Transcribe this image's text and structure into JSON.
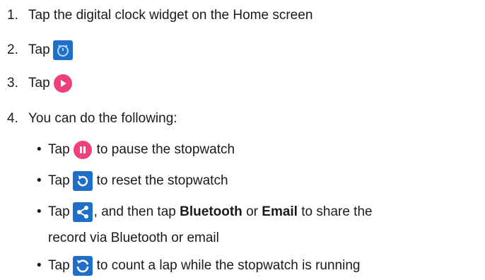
{
  "steps": [
    {
      "num": "1.",
      "text": "Tap the digital clock widget on the Home screen"
    },
    {
      "num": "2.",
      "pre": "Tap",
      "icon": "alarm-timer-icon"
    },
    {
      "num": "3.",
      "pre": "Tap",
      "icon": "play-icon"
    },
    {
      "num": "4.",
      "text": "You can do the following:"
    }
  ],
  "substeps": [
    {
      "bullet": "•",
      "pre": "Tap",
      "icon": "pause-icon",
      "post": "to pause the stopwatch"
    },
    {
      "bullet": "•",
      "pre": "Tap",
      "icon": "reset-icon",
      "post": "to reset the stopwatch"
    },
    {
      "bullet": "•",
      "pre": "Tap",
      "icon": "share-icon",
      "post_a": ", and then tap",
      "bold_a": "Bluetooth",
      "mid": "or",
      "bold_b": "Email",
      "post_b": "to share the",
      "cont": "record via Bluetooth or email"
    },
    {
      "bullet": "•",
      "pre": "Tap",
      "icon": "lap-icon",
      "post": "to count a lap while the stopwatch is running"
    }
  ],
  "colors": {
    "text": "#1a1a1a",
    "blue_tile": "#1f6fc8",
    "pink": "#f0407a"
  }
}
